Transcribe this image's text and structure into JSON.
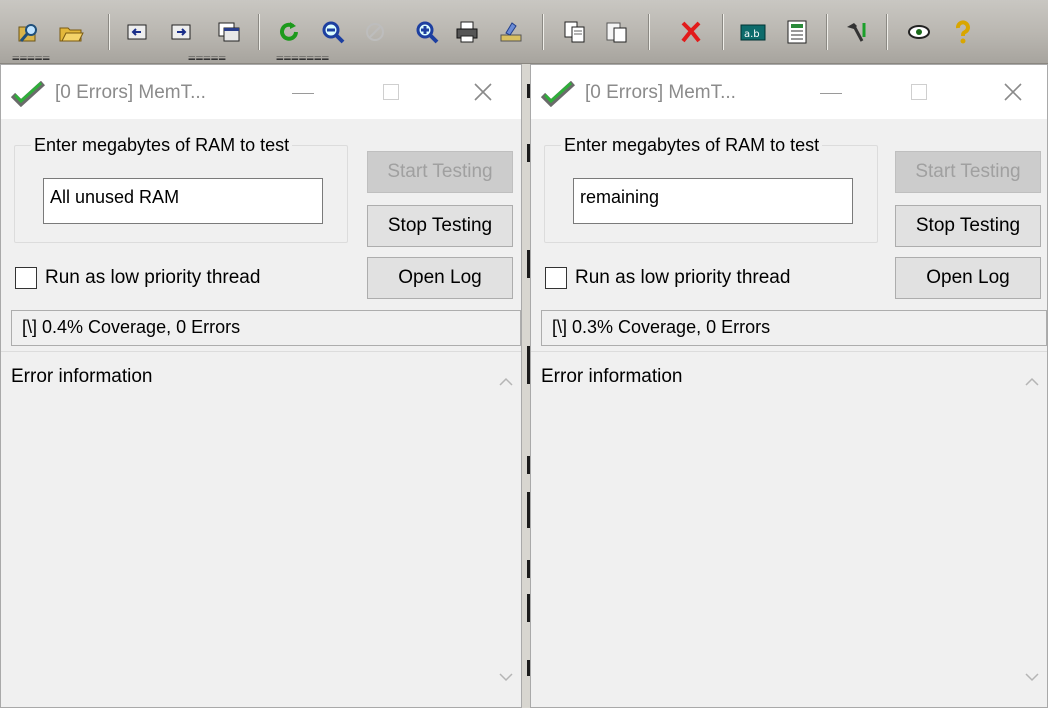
{
  "toolbar": {
    "icons": [
      "find-icon",
      "open-folder-icon",
      "prev-icon",
      "next-icon",
      "window-icon",
      "refresh-icon",
      "zoom-out-icon",
      "cancel-icon",
      "zoom-in-icon",
      "print-icon",
      "import-icon",
      "copy-icon",
      "paste-icon",
      "delete-icon",
      "text-field-icon",
      "form-icon",
      "tools-icon",
      "eye-icon",
      "help-icon"
    ]
  },
  "windows": [
    {
      "title": "[0 Errors] MemT...",
      "group_label": "Enter megabytes of RAM to test",
      "input_value": "All unused RAM",
      "start_label": "Start Testing",
      "stop_label": "Stop Testing",
      "log_label": "Open Log",
      "checkbox_label": "Run as low priority thread",
      "checkbox_checked": false,
      "status_text": "[\\]  0.4% Coverage, 0 Errors",
      "error_label": "Error information"
    },
    {
      "title": "[0 Errors] MemT...",
      "group_label": "Enter megabytes of RAM to test",
      "input_value": "remaining",
      "start_label": "Start Testing",
      "stop_label": "Stop Testing",
      "log_label": "Open Log",
      "checkbox_label": "Run as low priority thread",
      "checkbox_checked": false,
      "status_text": "[\\]  0.3% Coverage, 0 Errors",
      "error_label": "Error information"
    }
  ]
}
